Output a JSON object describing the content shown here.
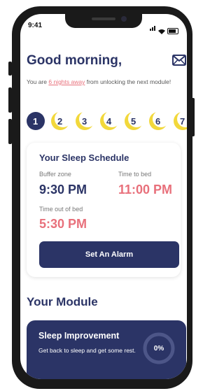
{
  "status_bar": {
    "time": "9:41"
  },
  "header": {
    "greeting": "Good morning,"
  },
  "progress": {
    "prefix": "You are ",
    "highlight": "6 nights away",
    "suffix": " from unlocking the next module!",
    "steps": [
      "1",
      "2",
      "3",
      "4",
      "5",
      "6",
      "7"
    ],
    "active_step": "1"
  },
  "schedule": {
    "title": "Your Sleep Schedule",
    "buffer_label": "Buffer zone",
    "buffer_value": "9:30 PM",
    "bed_label": "Time to bed",
    "bed_value": "11:00 PM",
    "out_label": "Time out of bed",
    "out_value": "5:30 PM",
    "alarm_button": "Set An Alarm"
  },
  "module_section": {
    "title": "Your Module",
    "card_title": "Sleep Improvement",
    "card_desc": "Get back to sleep and get some rest.",
    "progress_text": "0%",
    "progress_value": 0
  },
  "colors": {
    "navy": "#2b3466",
    "pink": "#e8707b",
    "moon": "#f2d83b"
  },
  "icons": [
    "mail-icon",
    "signal-icon",
    "wifi-icon",
    "battery-icon",
    "moon-icon"
  ]
}
